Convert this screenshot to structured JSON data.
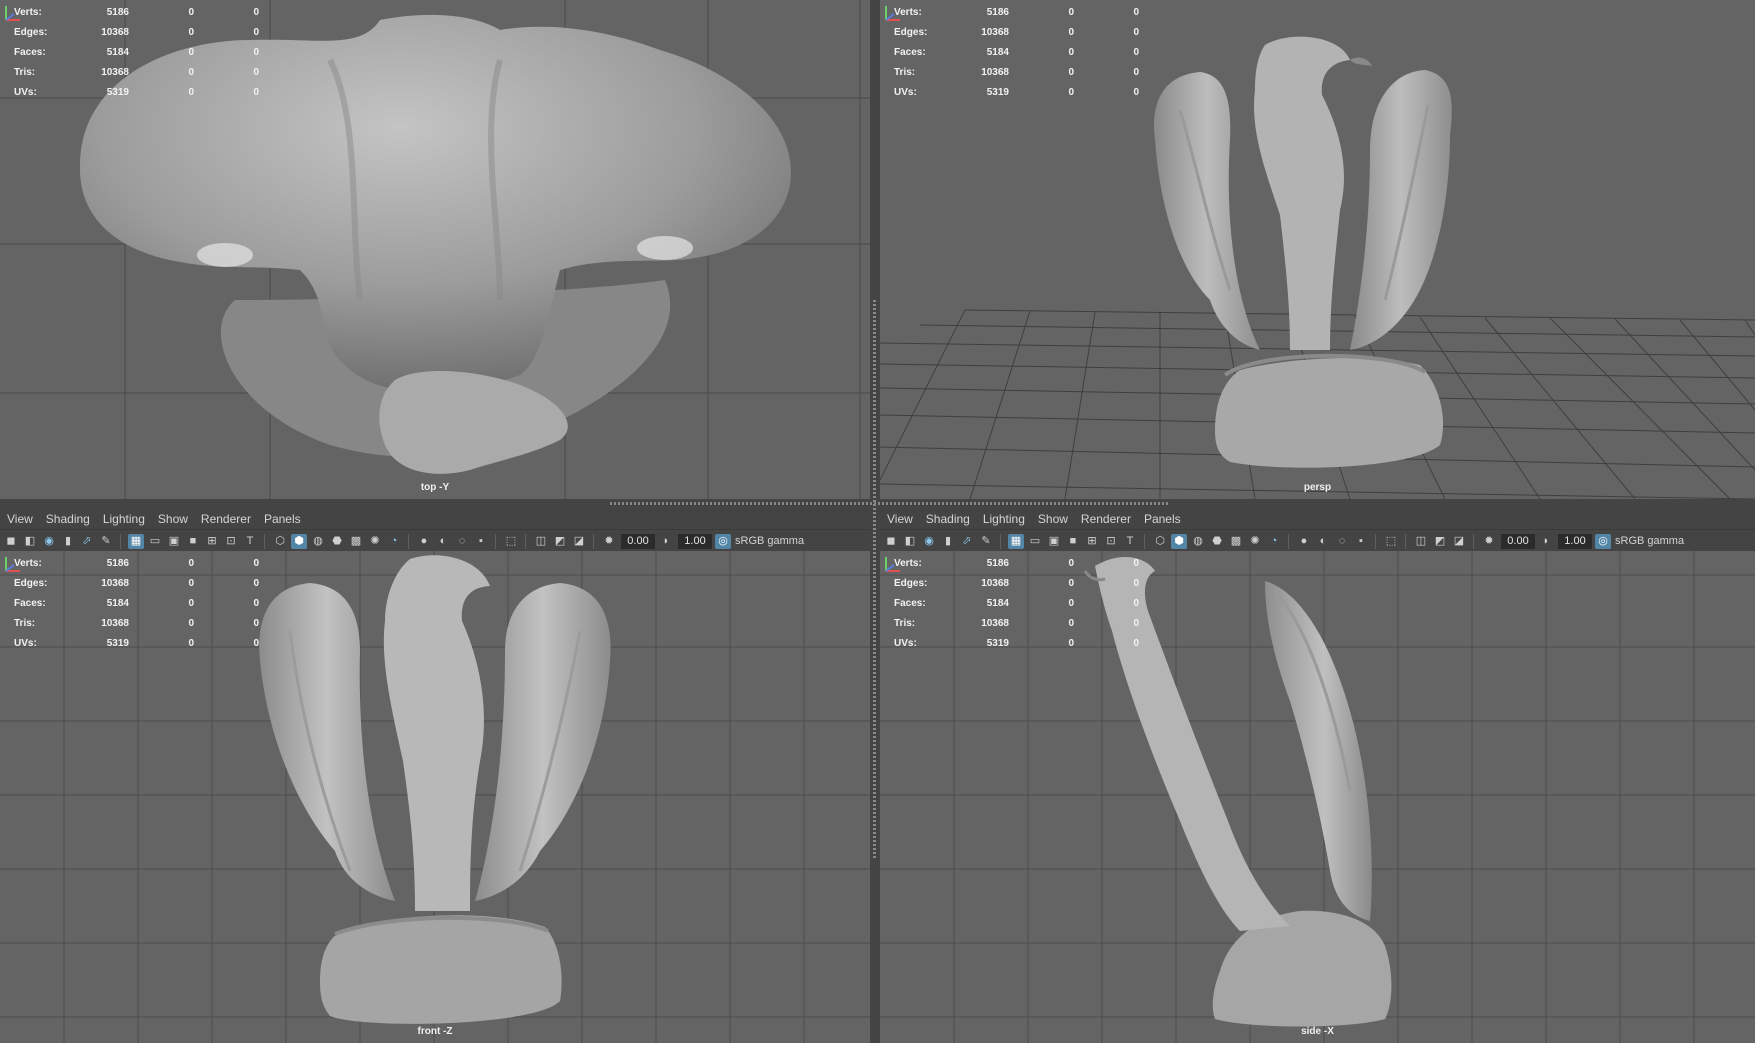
{
  "panel_menu": [
    "View",
    "Shading",
    "Lighting",
    "Show",
    "Renderer",
    "Panels"
  ],
  "toolbar": {
    "exposure_value": "0.00",
    "gamma_value": "1.00",
    "color_space_label": "sRGB gamma"
  },
  "hud": {
    "rows": [
      {
        "label": "Verts:",
        "total": "5186",
        "selected": "0",
        "components": "0"
      },
      {
        "label": "Edges:",
        "total": "10368",
        "selected": "0",
        "components": "0"
      },
      {
        "label": "Faces:",
        "total": "5184",
        "selected": "0",
        "components": "0"
      },
      {
        "label": "Tris:",
        "total": "10368",
        "selected": "0",
        "components": "0"
      },
      {
        "label": "UVs:",
        "total": "5319",
        "selected": "0",
        "components": "0"
      }
    ]
  },
  "viewports": {
    "top": {
      "camera_label": "top -Y"
    },
    "persp": {
      "camera_label": "persp"
    },
    "front": {
      "camera_label": "front -Z"
    },
    "side": {
      "camera_label": "side -X"
    }
  },
  "colors": {
    "background": "#646464",
    "panel_bar": "#444444",
    "active_button": "#5285a6",
    "grid_line": "#3e3e3e",
    "mesh_shade": "#a8a8a8"
  }
}
